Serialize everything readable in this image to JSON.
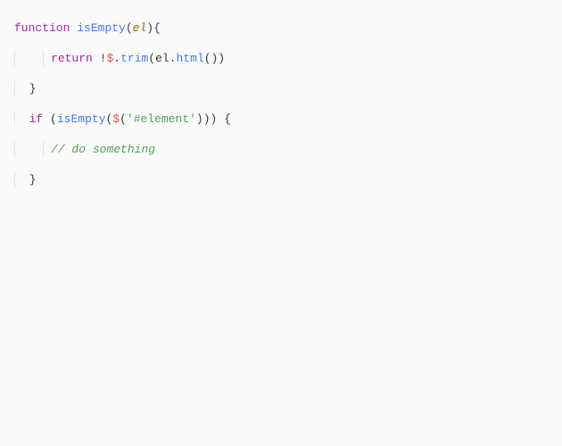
{
  "code": {
    "kw_function": "function",
    "fn_isEmpty_decl": "isEmpty",
    "paren_open": "(",
    "param_el": "el",
    "paren_close": ")",
    "brace_open": "{",
    "kw_return": "return",
    "bang": "!",
    "dollar": "$",
    "dot1": ".",
    "fn_trim": "trim",
    "ident_el": "el",
    "dot2": ".",
    "fn_html": "html",
    "unit_call": "()",
    "cparen1": ")",
    "brace_close1": "}",
    "kw_if": "if",
    "l_outer": "(",
    "fn_isEmpty_call": "isEmpty",
    "l_call": "(",
    "dollar2": "$",
    "l_jq": "(",
    "str_selector": "'#element'",
    "r_jq": ")",
    "r_call": ")",
    "r_outer": ")",
    "brace_open2": "{",
    "comment": "// do something",
    "brace_close2": "}"
  }
}
